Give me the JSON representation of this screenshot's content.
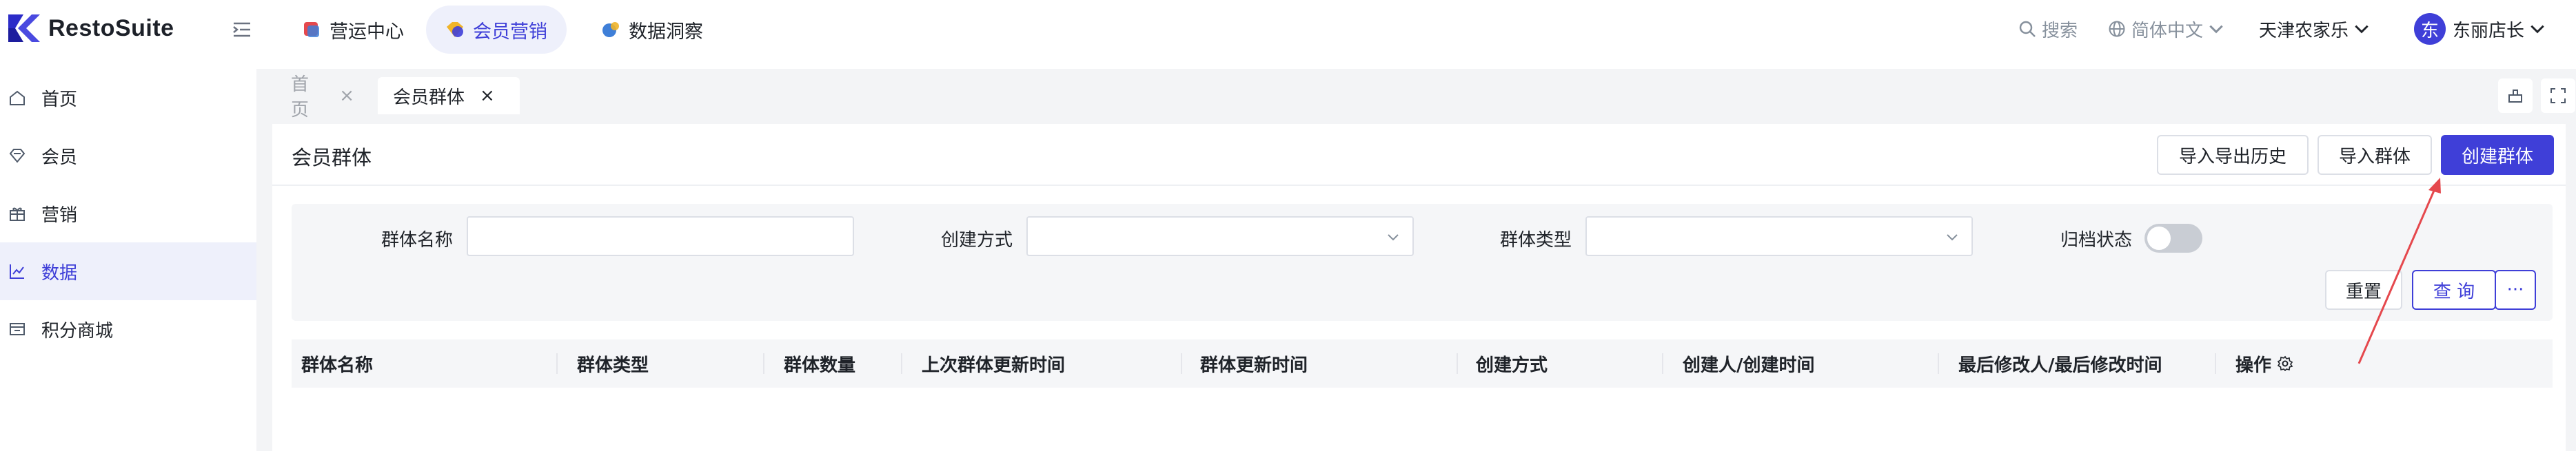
{
  "brand": {
    "name": "RestoSuite"
  },
  "top_nav": {
    "tabs": [
      {
        "label": "营运中心",
        "icon": "operations-cube-icon",
        "color": "#e5484d"
      },
      {
        "label": "会员营销",
        "icon": "member-marketing-icon",
        "color": "#f0b429",
        "active": true
      },
      {
        "label": "数据洞察",
        "icon": "data-insight-icon",
        "color": "#3f7fd8"
      }
    ],
    "search_label": "搜索",
    "language_label": "简体中文",
    "store_name": "天津农家乐",
    "user": {
      "avatar_initial": "东",
      "name": "东丽店长"
    }
  },
  "sidebar": {
    "items": [
      {
        "label": "首页",
        "icon": "home-icon"
      },
      {
        "label": "会员",
        "icon": "member-gem-icon"
      },
      {
        "label": "营销",
        "icon": "marketing-gift-icon"
      },
      {
        "label": "数据",
        "icon": "data-chart-icon",
        "active": true
      },
      {
        "label": "积分商城",
        "icon": "points-mall-icon"
      }
    ]
  },
  "page_tabs": [
    {
      "label": "首页",
      "close": "×",
      "active": false
    },
    {
      "label": "会员群体",
      "close": "×",
      "active": true
    }
  ],
  "panel": {
    "title": "会员群体",
    "actions": {
      "import_export_history": "导入导出历史",
      "import_group": "导入群体",
      "create_group": "创建群体"
    }
  },
  "filters": {
    "group_name_label": "群体名称",
    "group_name_value": "",
    "create_method_label": "创建方式",
    "create_method_value": "",
    "group_type_label": "群体类型",
    "group_type_value": "",
    "archive_status_label": "归档状态",
    "archive_status_on": false,
    "reset_label": "重置",
    "query_label": "查 询",
    "more_label": "···"
  },
  "table": {
    "columns": [
      "群体名称",
      "群体类型",
      "群体数量",
      "上次群体更新时间",
      "群体更新时间",
      "创建方式",
      "创建人/创建时间",
      "最后修改人/最后修改时间",
      "操作"
    ],
    "rows": []
  },
  "colors": {
    "primary": "#3f3fd8",
    "active_bg": "#eef0fb",
    "annotation_arrow": "#e5484d"
  }
}
